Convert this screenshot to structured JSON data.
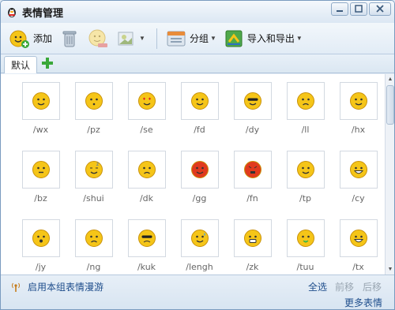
{
  "window": {
    "title": "表情管理"
  },
  "toolbar": {
    "add_label": "添加",
    "group_label": "分组",
    "import_export_label": "导入和导出"
  },
  "tabs": [
    {
      "label": "默认"
    }
  ],
  "emoticons": [
    {
      "code": "/wx",
      "face": "smile"
    },
    {
      "code": "/pz",
      "face": "pout"
    },
    {
      "code": "/se",
      "face": "love"
    },
    {
      "code": "/fd",
      "face": "daze"
    },
    {
      "code": "/dy",
      "face": "cool"
    },
    {
      "code": "/ll",
      "face": "tears"
    },
    {
      "code": "/hx",
      "face": "shy"
    },
    {
      "code": "/bz",
      "face": "mute"
    },
    {
      "code": "/shui",
      "face": "sleep"
    },
    {
      "code": "/dk",
      "face": "cry"
    },
    {
      "code": "/gg",
      "face": "embarrassed"
    },
    {
      "code": "/fn",
      "face": "angry"
    },
    {
      "code": "/tp",
      "face": "cheeky"
    },
    {
      "code": "/cy",
      "face": "grin"
    },
    {
      "code": "/jy",
      "face": "surprised"
    },
    {
      "code": "/ng",
      "face": "sad"
    },
    {
      "code": "/kuk",
      "face": "cool-cry"
    },
    {
      "code": "/lengh",
      "face": "sweat"
    },
    {
      "code": "/zk",
      "face": "crazy"
    },
    {
      "code": "/tuu",
      "face": "vomit"
    },
    {
      "code": "/tx",
      "face": "giggle"
    }
  ],
  "footer": {
    "roam_label": "启用本组表情漫游",
    "select_all": "全选",
    "move_forward": "前移",
    "move_back": "后移",
    "more_emoticons": "更多表情"
  },
  "colors": {
    "face_yellow": "#f5c518",
    "face_red": "#e03a1e",
    "link_blue": "#1f4e8c"
  }
}
